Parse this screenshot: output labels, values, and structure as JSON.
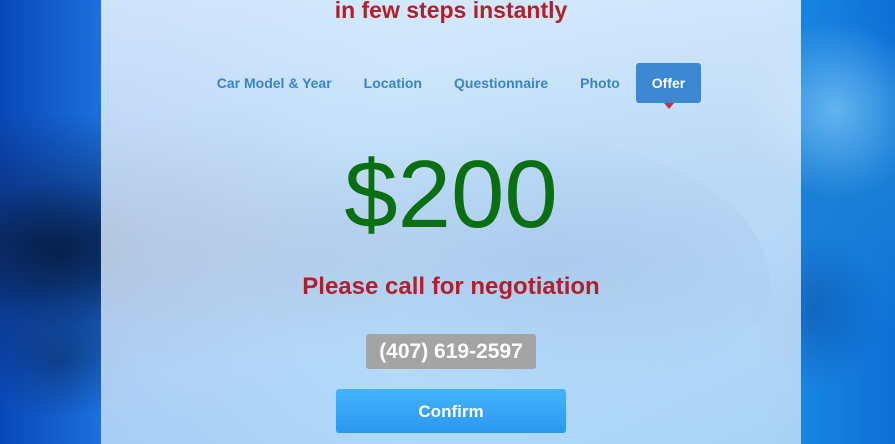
{
  "header": {
    "headline": "in few steps instantly"
  },
  "steps": [
    {
      "label": "Car Model & Year",
      "active": false
    },
    {
      "label": "Location",
      "active": false
    },
    {
      "label": "Questionnaire",
      "active": false
    },
    {
      "label": "Photo",
      "active": false
    },
    {
      "label": "Offer",
      "active": true
    }
  ],
  "offer": {
    "price": "$200",
    "note": "Please call for negotiation",
    "phone": "(407) 619-2597",
    "confirm_label": "Confirm"
  },
  "colors": {
    "headline": "#b0202a",
    "price": "#0a6e12",
    "step_link": "#3a83c4",
    "step_active_bg": "#3d88d2",
    "confirm_bg": "#2b97ef",
    "phone_bg": "#a4a4a4"
  }
}
